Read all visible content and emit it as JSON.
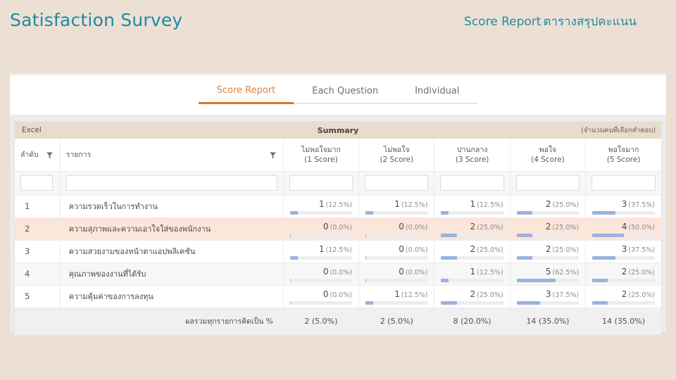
{
  "header": {
    "app_title": "Satisfaction Survey",
    "right_en": "Score Report",
    "right_th": "ตารางสรุปคะแนน",
    "accent_color": "#2189a0"
  },
  "tabs": [
    {
      "label": "Score Report",
      "active": true
    },
    {
      "label": "Each Question",
      "active": false
    },
    {
      "label": "Individual",
      "active": false
    }
  ],
  "tab_active_color": "#d9782e",
  "summary_bar": {
    "left_label": "Excel",
    "center_label": "Summary",
    "right_label": "(จำนวนคนที่เลือกคำตอบ)",
    "background": "#e9dccd"
  },
  "table": {
    "columns": [
      {
        "key": "seq",
        "label": "ลำดับ",
        "sub": "",
        "filter": true
      },
      {
        "key": "item",
        "label": "รายการ",
        "sub": "",
        "filter": true
      },
      {
        "key": "s1",
        "label": "ไม่พอใจมาก",
        "sub": "(1 Score)",
        "filter": false
      },
      {
        "key": "s2",
        "label": "ไม่พอใจ",
        "sub": "(2 Score)",
        "filter": false
      },
      {
        "key": "s3",
        "label": "ปานกลาง",
        "sub": "(3 Score)",
        "filter": false
      },
      {
        "key": "s4",
        "label": "พอใจ",
        "sub": "(4 Score)",
        "filter": false
      },
      {
        "key": "s5",
        "label": "พอใจมาก",
        "sub": "(5 Score)",
        "filter": false
      }
    ],
    "filter_inputs": [
      {
        "value": "",
        "placeholder": ""
      },
      {
        "value": "",
        "placeholder": ""
      },
      {
        "value": "",
        "placeholder": ""
      },
      {
        "value": "",
        "placeholder": ""
      },
      {
        "value": "",
        "placeholder": ""
      },
      {
        "value": "",
        "placeholder": ""
      },
      {
        "value": "",
        "placeholder": ""
      }
    ],
    "rows": [
      {
        "seq": "1",
        "item": "ความรวดเร็วในการทำงาน",
        "highlight": "none",
        "scores": [
          {
            "count": "1",
            "pct": "(12.5%)",
            "pct_value": 12.5
          },
          {
            "count": "1",
            "pct": "(12.5%)",
            "pct_value": 12.5
          },
          {
            "count": "1",
            "pct": "(12.5%)",
            "pct_value": 12.5
          },
          {
            "count": "2",
            "pct": "(25.0%)",
            "pct_value": 25.0
          },
          {
            "count": "3",
            "pct": "(37.5%)",
            "pct_value": 37.5
          }
        ]
      },
      {
        "seq": "2",
        "item": "ความสุภาพและความเอาใจใส่ของพนักงาน",
        "highlight": "hover",
        "scores": [
          {
            "count": "0",
            "pct": "(0.0%)",
            "pct_value": 0.0
          },
          {
            "count": "0",
            "pct": "(0.0%)",
            "pct_value": 0.0
          },
          {
            "count": "2",
            "pct": "(25.0%)",
            "pct_value": 25.0
          },
          {
            "count": "2",
            "pct": "(25.0%)",
            "pct_value": 25.0
          },
          {
            "count": "4",
            "pct": "(50.0%)",
            "pct_value": 50.0
          }
        ]
      },
      {
        "seq": "3",
        "item": "ความสวยงามของหน้าตาแอปพลิเคชัน",
        "highlight": "none",
        "scores": [
          {
            "count": "1",
            "pct": "(12.5%)",
            "pct_value": 12.5
          },
          {
            "count": "0",
            "pct": "(0.0%)",
            "pct_value": 0.0
          },
          {
            "count": "2",
            "pct": "(25.0%)",
            "pct_value": 25.0
          },
          {
            "count": "2",
            "pct": "(25.0%)",
            "pct_value": 25.0
          },
          {
            "count": "3",
            "pct": "(37.5%)",
            "pct_value": 37.5
          }
        ]
      },
      {
        "seq": "4",
        "item": "คุณภาพของงานที่ได้รับ",
        "highlight": "alt",
        "scores": [
          {
            "count": "0",
            "pct": "(0.0%)",
            "pct_value": 0.0
          },
          {
            "count": "0",
            "pct": "(0.0%)",
            "pct_value": 0.0
          },
          {
            "count": "1",
            "pct": "(12.5%)",
            "pct_value": 12.5
          },
          {
            "count": "5",
            "pct": "(62.5%)",
            "pct_value": 62.5
          },
          {
            "count": "2",
            "pct": "(25.0%)",
            "pct_value": 25.0
          }
        ]
      },
      {
        "seq": "5",
        "item": "ความคุ้มค่าของการลงทุน",
        "highlight": "none",
        "scores": [
          {
            "count": "0",
            "pct": "(0.0%)",
            "pct_value": 0.0
          },
          {
            "count": "1",
            "pct": "(12.5%)",
            "pct_value": 12.5
          },
          {
            "count": "2",
            "pct": "(25.0%)",
            "pct_value": 25.0
          },
          {
            "count": "3",
            "pct": "(37.5%)",
            "pct_value": 37.5
          },
          {
            "count": "2",
            "pct": "(25.0%)",
            "pct_value": 25.0
          }
        ]
      }
    ],
    "footer": {
      "label": "ผลรวมทุกรายการคิดเป็น %",
      "totals": [
        "2 (5.0%)",
        "2 (5.0%)",
        "8 (20.0%)",
        "14 (35.0%)",
        "14 (35.0%)"
      ]
    }
  },
  "chart_data": {
    "type": "bar",
    "title": "Summary",
    "categories": [
      "ความรวดเร็วในการทำงาน",
      "ความสุภาพและความเอาใจใส่ของพนักงาน",
      "ความสวยงามของหน้าตาแอปพลิเคชัน",
      "คุณภาพของงานที่ได้รับ",
      "ความคุ้มค่าของการลงทุน"
    ],
    "series": [
      {
        "name": "ไม่พอใจมาก (1 Score)",
        "values": [
          1,
          0,
          1,
          0,
          0
        ],
        "percents": [
          12.5,
          0.0,
          12.5,
          0.0,
          0.0
        ]
      },
      {
        "name": "ไม่พอใจ (2 Score)",
        "values": [
          1,
          0,
          0,
          0,
          1
        ],
        "percents": [
          12.5,
          0.0,
          0.0,
          0.0,
          12.5
        ]
      },
      {
        "name": "ปานกลาง (3 Score)",
        "values": [
          1,
          2,
          2,
          1,
          2
        ],
        "percents": [
          12.5,
          25.0,
          25.0,
          12.5,
          25.0
        ]
      },
      {
        "name": "พอใจ (4 Score)",
        "values": [
          2,
          2,
          2,
          5,
          3
        ],
        "percents": [
          25.0,
          25.0,
          25.0,
          62.5,
          37.5
        ]
      },
      {
        "name": "พอใจมาก (5 Score)",
        "values": [
          3,
          4,
          3,
          2,
          2
        ],
        "percents": [
          37.5,
          50.0,
          37.5,
          25.0,
          25.0
        ]
      }
    ],
    "totals": {
      "counts": [
        2,
        2,
        8,
        14,
        14
      ],
      "percents": [
        5.0,
        5.0,
        20.0,
        35.0,
        35.0
      ]
    },
    "ylim": [
      0,
      100
    ],
    "ylabel": "%",
    "xlabel": "",
    "grid": false,
    "legend": "top"
  }
}
